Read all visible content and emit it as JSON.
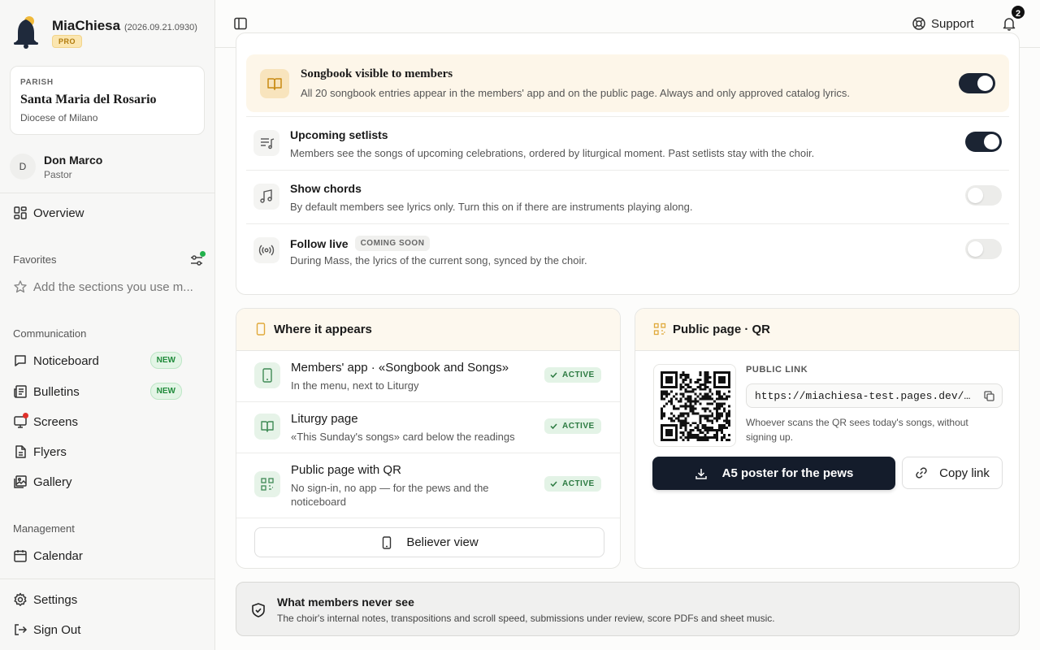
{
  "app": {
    "name": "MiaChiesa",
    "version": "(2026.09.21.0930)",
    "plan_badge": "PRO"
  },
  "parish": {
    "label": "PARISH",
    "name": "Santa Maria del Rosario",
    "diocese": "Diocese of Milano"
  },
  "user": {
    "initial": "D",
    "name": "Don Marco",
    "role": "Pastor"
  },
  "nav": {
    "overview": "Overview",
    "favorites_label": "Favorites",
    "favorites_add": "Add the sections you use m...",
    "communication_label": "Communication",
    "communication": [
      {
        "label": "Noticeboard",
        "badge": "NEW",
        "icon": "message-icon"
      },
      {
        "label": "Bulletins",
        "badge": "NEW",
        "icon": "newspaper-icon"
      },
      {
        "label": "Screens",
        "badge": "",
        "icon": "screen-icon",
        "alert": true
      },
      {
        "label": "Flyers",
        "badge": "",
        "icon": "file-icon"
      },
      {
        "label": "Gallery",
        "badge": "",
        "icon": "gallery-icon"
      }
    ],
    "management_label": "Management",
    "calendar": "Calendar",
    "settings": "Settings",
    "sign_out": "Sign Out"
  },
  "topbar": {
    "support": "Support",
    "notifications_count": "2"
  },
  "settings": {
    "songbook": {
      "title": "Songbook visible to members",
      "desc": "All 20 songbook entries appear in the members' app and on the public page. Always and only approved catalog lyrics.",
      "on": true
    },
    "rows": [
      {
        "title": "Upcoming setlists",
        "desc": "Members see the songs of upcoming celebrations, ordered by liturgical moment. Past setlists stay with the choir.",
        "on": true,
        "tag": ""
      },
      {
        "title": "Show chords",
        "desc": "By default members see lyrics only. Turn this on if there are instruments playing along.",
        "on": false,
        "tag": ""
      },
      {
        "title": "Follow live",
        "desc": "During Mass, the lyrics of the current song, synced by the choir.",
        "on": false,
        "tag": "COMING SOON"
      }
    ]
  },
  "where": {
    "title": "Where it appears",
    "items": [
      {
        "title": "Members' app · «Songbook and Songs»",
        "desc": "In the menu, next to Liturgy",
        "status": "ACTIVE"
      },
      {
        "title": "Liturgy page",
        "desc": "«This Sunday's songs» card below the readings",
        "status": "ACTIVE"
      },
      {
        "title": "Public page with QR",
        "desc": "No sign-in, no app — for the pews and the noticeboard",
        "status": "ACTIVE"
      }
    ],
    "believer_view": "Believer view"
  },
  "public": {
    "title": "Public page · QR",
    "link_label": "PUBLIC LINK",
    "link": "https://miachiesa-test.pages.dev/parish/santa-maria-del-rosario/songs",
    "note": "Whoever scans the QR sees today's songs, without signing up.",
    "poster_button": "A5 poster for the pews",
    "copy_button": "Copy link"
  },
  "never": {
    "title": "What members never see",
    "desc": "The choir's internal notes, transpositions and scroll speed, submissions under review, score PDFs and sheet music."
  },
  "colors": {
    "accent_dark": "#141c2b",
    "brand_gold": "#f0b93a",
    "active_green": "#2c7a41",
    "alert_red": "#e0312b"
  }
}
